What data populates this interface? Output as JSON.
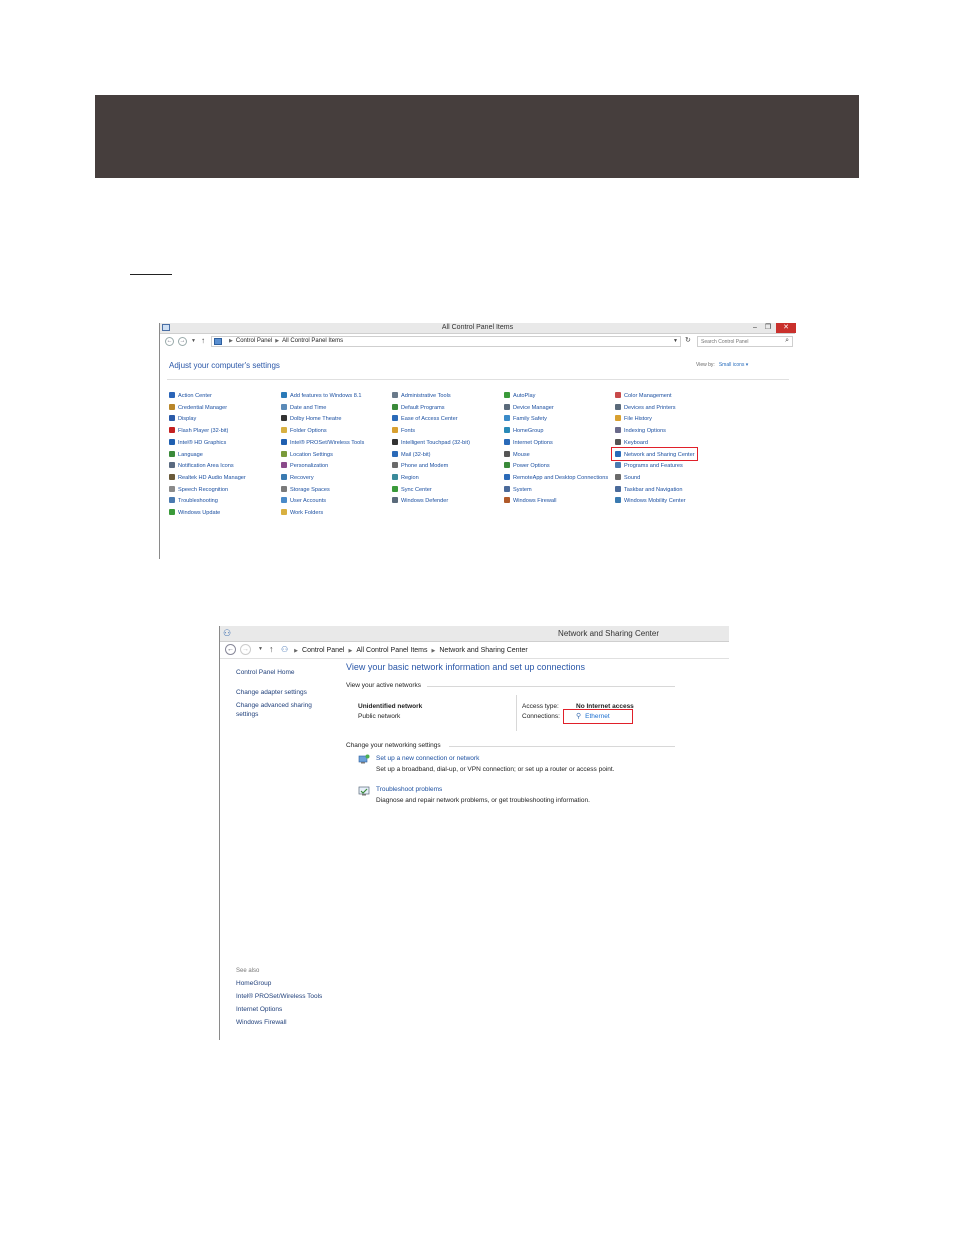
{
  "colors": {
    "banner": "#463e3d",
    "link": "#1b4fa0",
    "heading": "#2a57a8",
    "highlight": "#e0202a"
  },
  "control_panel": {
    "title": "All Control Panel Items",
    "breadcrumb": [
      "Control Panel",
      "All Control Panel Items"
    ],
    "search_placeholder": "Search Control Panel",
    "heading": "Adjust your computer's settings",
    "view_by_label": "View by:",
    "view_by_value": "Small icons",
    "columns": [
      [
        {
          "label": "Action Center",
          "icon": "flag-icon",
          "color": "#2a64b8"
        },
        {
          "label": "Credential Manager",
          "icon": "vault-icon",
          "color": "#b8862a"
        },
        {
          "label": "Display",
          "icon": "monitor-icon",
          "color": "#2a5aa8"
        },
        {
          "label": "Flash Player (32-bit)",
          "icon": "flash-icon",
          "color": "#c42020"
        },
        {
          "label": "Intel® HD Graphics",
          "icon": "intel-icon",
          "color": "#1f5fb0"
        },
        {
          "label": "Language",
          "icon": "globe-icon",
          "color": "#3a8a3a"
        },
        {
          "label": "Notification Area Icons",
          "icon": "tray-icon",
          "color": "#5a6a80"
        },
        {
          "label": "Realtek HD Audio Manager",
          "icon": "speaker-icon",
          "color": "#6a5a3a"
        },
        {
          "label": "Speech Recognition",
          "icon": "microphone-icon",
          "color": "#8a8a8a"
        },
        {
          "label": "Troubleshooting",
          "icon": "wrench-icon",
          "color": "#4a7ab0"
        },
        {
          "label": "Windows Update",
          "icon": "update-icon",
          "color": "#3a9a3a"
        }
      ],
      [
        {
          "label": "Add features to Windows 8.1",
          "icon": "windows-icon",
          "color": "#2a7ab8"
        },
        {
          "label": "Date and Time",
          "icon": "clock-icon",
          "color": "#5a8ab8"
        },
        {
          "label": "Dolby Home Theatre",
          "icon": "dolby-icon",
          "color": "#333333"
        },
        {
          "label": "Folder Options",
          "icon": "folder-icon",
          "color": "#d8b040"
        },
        {
          "label": "Intel® PROSet/Wireless Tools",
          "icon": "wireless-icon",
          "color": "#1f5fb0"
        },
        {
          "label": "Location Settings",
          "icon": "location-icon",
          "color": "#7a9a3a"
        },
        {
          "label": "Personalization",
          "icon": "palette-icon",
          "color": "#8a4a8a"
        },
        {
          "label": "Recovery",
          "icon": "recovery-icon",
          "color": "#3a7ab0"
        },
        {
          "label": "Storage Spaces",
          "icon": "storage-icon",
          "color": "#7a7a7a"
        },
        {
          "label": "User Accounts",
          "icon": "users-icon",
          "color": "#4a8ac8"
        },
        {
          "label": "Work Folders",
          "icon": "folder-icon",
          "color": "#d8b040"
        }
      ],
      [
        {
          "label": "Administrative Tools",
          "icon": "tools-icon",
          "color": "#6a7a8a"
        },
        {
          "label": "Default Programs",
          "icon": "programs-icon",
          "color": "#3a8a3a"
        },
        {
          "label": "Ease of Access Center",
          "icon": "access-icon",
          "color": "#2a6ab8"
        },
        {
          "label": "Fonts",
          "icon": "font-icon",
          "color": "#d8a030"
        },
        {
          "label": "Intelligent Touchpad (32-bit)",
          "icon": "touchpad-icon",
          "color": "#333333"
        },
        {
          "label": "Mail (32-bit)",
          "icon": "mail-icon",
          "color": "#2a6ab8"
        },
        {
          "label": "Phone and Modem",
          "icon": "phone-icon",
          "color": "#6a6a6a"
        },
        {
          "label": "Region",
          "icon": "globe-icon",
          "color": "#3a8a9a"
        },
        {
          "label": "Sync Center",
          "icon": "sync-icon",
          "color": "#3a9a3a"
        },
        {
          "label": "Windows Defender",
          "icon": "shield-icon",
          "color": "#5a6a7a"
        }
      ],
      [
        {
          "label": "AutoPlay",
          "icon": "autoplay-icon",
          "color": "#3a9a3a"
        },
        {
          "label": "Device Manager",
          "icon": "device-icon",
          "color": "#5a6a7a"
        },
        {
          "label": "Family Safety",
          "icon": "family-icon",
          "color": "#3a8ac8"
        },
        {
          "label": "HomeGroup",
          "icon": "homegroup-icon",
          "color": "#2a8ab8"
        },
        {
          "label": "Internet Options",
          "icon": "internet-icon",
          "color": "#2a6ab8"
        },
        {
          "label": "Mouse",
          "icon": "mouse-icon",
          "color": "#555555"
        },
        {
          "label": "Power Options",
          "icon": "power-icon",
          "color": "#3a8a3a"
        },
        {
          "label": "RemoteApp and Desktop Connections",
          "icon": "remote-icon",
          "color": "#2a6ab8"
        },
        {
          "label": "System",
          "icon": "system-icon",
          "color": "#4a6a9a"
        },
        {
          "label": "Windows Firewall",
          "icon": "firewall-icon",
          "color": "#b05a2a"
        }
      ],
      [
        {
          "label": "Color Management",
          "icon": "color-icon",
          "color": "#c84a4a"
        },
        {
          "label": "Devices and Printers",
          "icon": "printer-icon",
          "color": "#5a6a7a"
        },
        {
          "label": "File History",
          "icon": "history-icon",
          "color": "#d8a030"
        },
        {
          "label": "Indexing Options",
          "icon": "index-icon",
          "color": "#6a6a8a"
        },
        {
          "label": "Keyboard",
          "icon": "keyboard-icon",
          "color": "#555555"
        },
        {
          "label": "Network and Sharing Center",
          "icon": "network-icon",
          "color": "#2a6ab8"
        },
        {
          "label": "Programs and Features",
          "icon": "programs-icon",
          "color": "#4a7ab0"
        },
        {
          "label": "Sound",
          "icon": "sound-icon",
          "color": "#6a6a6a"
        },
        {
          "label": "Taskbar and Navigation",
          "icon": "taskbar-icon",
          "color": "#4a6a9a"
        },
        {
          "label": "Windows Mobility Center",
          "icon": "mobility-icon",
          "color": "#3a7ab0"
        }
      ]
    ]
  },
  "network_center": {
    "title": "Network and Sharing Center",
    "breadcrumb": [
      "Control Panel",
      "All Control Panel Items",
      "Network and Sharing Center"
    ],
    "left_nav": {
      "home": "Control Panel Home",
      "links": [
        "Change adapter settings",
        "Change advanced sharing",
        "settings"
      ],
      "see_also_label": "See also",
      "see_also": [
        "HomeGroup",
        "Intel® PROSet/Wireless Tools",
        "Internet Options",
        "Windows Firewall"
      ]
    },
    "main_title": "View your basic network information and set up connections",
    "active_networks_label": "View your active networks",
    "network_name": "Unidentified network",
    "network_type": "Public network",
    "access_type_label": "Access type:",
    "access_type_value": "No Internet access",
    "connections_label": "Connections:",
    "connection_value": "Ethernet",
    "change_settings_label": "Change your networking settings",
    "tasks": [
      {
        "title": "Set up a new connection or network",
        "desc": "Set up a broadband, dial-up, or VPN connection; or set up a router or access point."
      },
      {
        "title": "Troubleshoot problems",
        "desc": "Diagnose and repair network problems, or get troubleshooting information."
      }
    ]
  }
}
